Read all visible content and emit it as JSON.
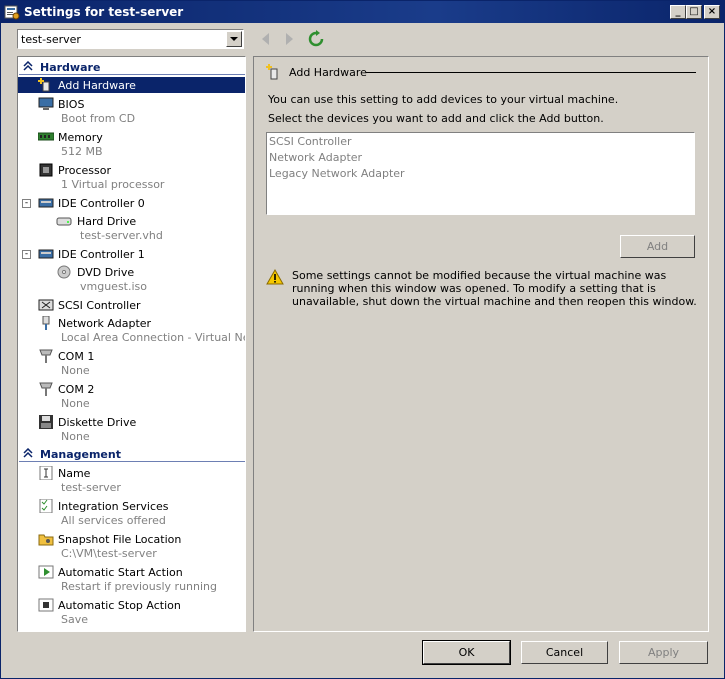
{
  "window": {
    "title": "Settings for test-server"
  },
  "vm_selector": {
    "value": "test-server"
  },
  "tree": {
    "hardware_header": "Hardware",
    "management_header": "Management",
    "hardware_items": [
      {
        "label": "Add Hardware",
        "sub": ""
      },
      {
        "label": "BIOS",
        "sub": "Boot from CD"
      },
      {
        "label": "Memory",
        "sub": "512 MB"
      },
      {
        "label": "Processor",
        "sub": "1 Virtual processor"
      },
      {
        "label": "IDE Controller 0",
        "sub": ""
      },
      {
        "label": "Hard Drive",
        "sub": "test-server.vhd"
      },
      {
        "label": "IDE Controller 1",
        "sub": ""
      },
      {
        "label": "DVD Drive",
        "sub": "vmguest.iso"
      },
      {
        "label": "SCSI Controller",
        "sub": ""
      },
      {
        "label": "Network Adapter",
        "sub": "Local Area Connection - Virtual Net..."
      },
      {
        "label": "COM 1",
        "sub": "None"
      },
      {
        "label": "COM 2",
        "sub": "None"
      },
      {
        "label": "Diskette Drive",
        "sub": "None"
      }
    ],
    "management_items": [
      {
        "label": "Name",
        "sub": "test-server"
      },
      {
        "label": "Integration Services",
        "sub": "All services offered"
      },
      {
        "label": "Snapshot File Location",
        "sub": "C:\\VM\\test-server"
      },
      {
        "label": "Automatic Start Action",
        "sub": "Restart if previously running"
      },
      {
        "label": "Automatic Stop Action",
        "sub": "Save"
      }
    ]
  },
  "panel": {
    "title": "Add Hardware",
    "desc1": "You can use this setting to add devices to your virtual machine.",
    "desc2": "Select the devices you want to add and click the Add button.",
    "devices": [
      "SCSI Controller",
      "Network Adapter",
      "Legacy Network Adapter"
    ],
    "add_label": "Add",
    "warning": "Some settings cannot be modified because the virtual machine was running when this window was opened. To modify a setting that is unavailable, shut down the virtual machine and then reopen this window."
  },
  "footer": {
    "ok": "OK",
    "cancel": "Cancel",
    "apply": "Apply"
  }
}
